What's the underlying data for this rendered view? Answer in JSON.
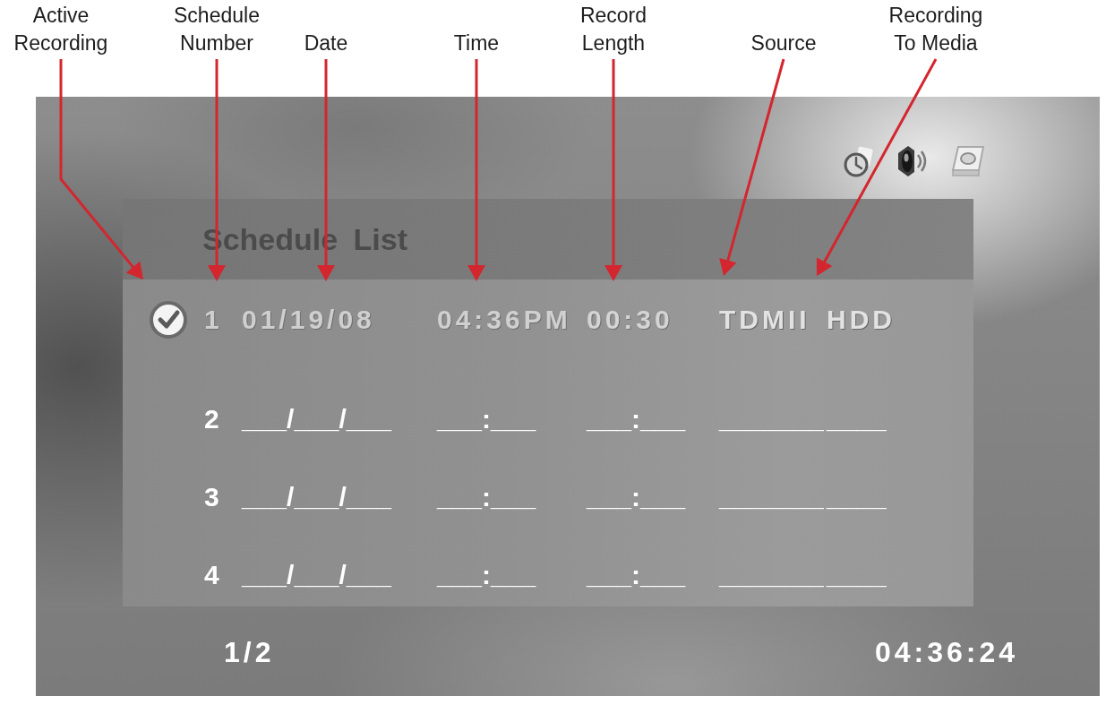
{
  "callouts": [
    {
      "label": "Active Recording"
    },
    {
      "label": "Schedule Number"
    },
    {
      "label": "Date"
    },
    {
      "label": "Time"
    },
    {
      "label": "Record Length"
    },
    {
      "label": "Source"
    },
    {
      "label": "Recording To Media"
    }
  ],
  "screen": {
    "title": "Schedule List",
    "rows": [
      {
        "number": "1",
        "active": true,
        "date": "01/19/08",
        "time": "04:36PM",
        "length": "00:30",
        "source": "TDMII",
        "media": "HDD"
      },
      {
        "number": "2",
        "active": false,
        "date": "___/___/___",
        "time": "___:___",
        "length": "___:___",
        "source": "_______",
        "media": "____"
      },
      {
        "number": "3",
        "active": false,
        "date": "___/___/___",
        "time": "___:___",
        "length": "___:___",
        "source": "_______",
        "media": "____"
      },
      {
        "number": "4",
        "active": false,
        "date": "___/___/___",
        "time": "___:___",
        "length": "___:___",
        "source": "_______",
        "media": "____"
      }
    ],
    "page": "1/2",
    "clock": "04:36:24"
  }
}
